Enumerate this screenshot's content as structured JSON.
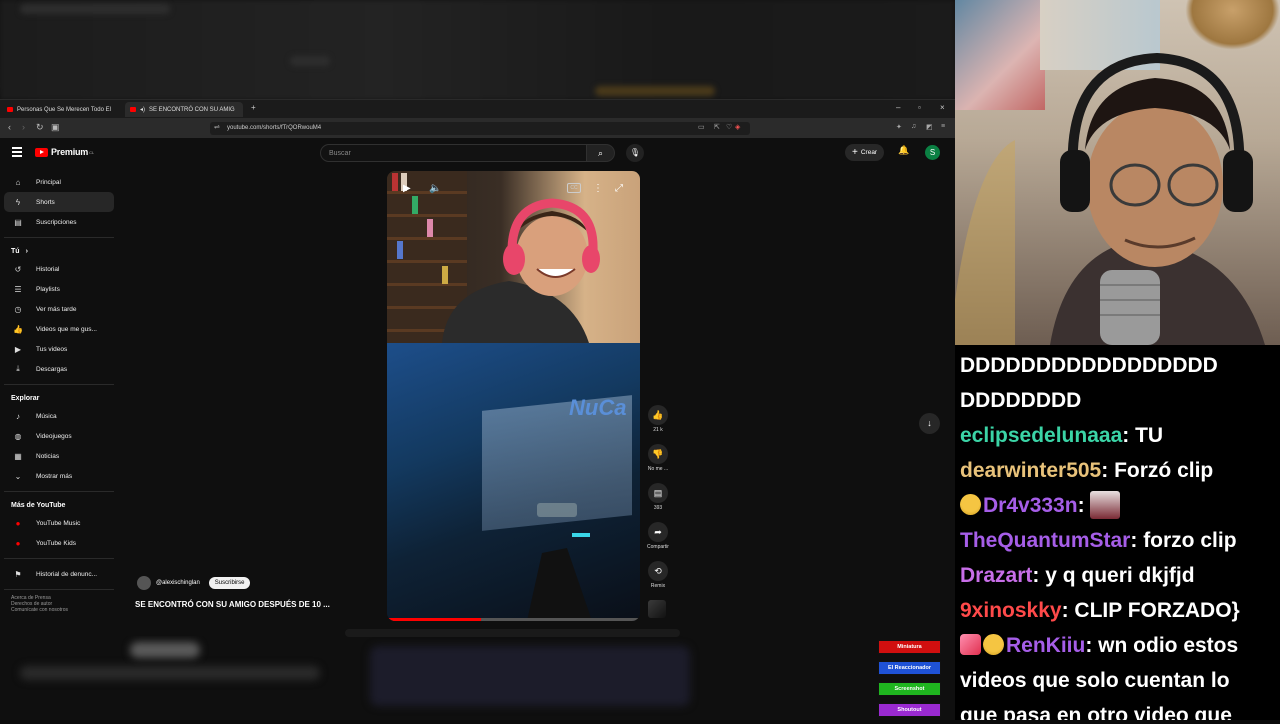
{
  "browser": {
    "tabs": [
      {
        "label": "Personas Que Se Merecen Todo El"
      },
      {
        "label": "SE ENCONTRÓ CON SU AMIG"
      }
    ],
    "url": "youtube.com/shorts/fTrQORwouM4"
  },
  "youtube": {
    "logo": "Premium",
    "logo_region": "CL",
    "search_placeholder": "Buscar",
    "create_label": "Crear",
    "avatar_letter": "S"
  },
  "sidebar": {
    "main": [
      {
        "label": "Principal",
        "icon": "home-icon"
      },
      {
        "label": "Shorts",
        "icon": "shorts-icon",
        "active": true
      },
      {
        "label": "Suscripciones",
        "icon": "subscriptions-icon"
      }
    ],
    "you_header": "Tú",
    "you": [
      {
        "label": "Historial",
        "icon": "history-icon"
      },
      {
        "label": "Playlists",
        "icon": "playlists-icon"
      },
      {
        "label": "Ver más tarde",
        "icon": "watch-later-icon"
      },
      {
        "label": "Videos que me gus...",
        "icon": "like-icon"
      },
      {
        "label": "Tus videos",
        "icon": "your-videos-icon"
      },
      {
        "label": "Descargas",
        "icon": "download-icon"
      }
    ],
    "explore_header": "Explorar",
    "explore": [
      {
        "label": "Música",
        "icon": "music-icon"
      },
      {
        "label": "Videojuegos",
        "icon": "gaming-icon"
      },
      {
        "label": "Noticias",
        "icon": "news-icon"
      },
      {
        "label": "Mostrar más",
        "icon": "chevron-down-icon"
      }
    ],
    "more_header": "Más de YouTube",
    "more": [
      {
        "label": "YouTube Music",
        "icon": "youtube-music-icon"
      },
      {
        "label": "YouTube Kids",
        "icon": "youtube-kids-icon"
      }
    ],
    "report": "Historial de denunc...",
    "footer": [
      "Acerca de  Prensa",
      "Derechos de autor",
      "Comunícate con nosotros"
    ]
  },
  "short": {
    "channel": "@alexischinglan",
    "subscribe": "Suscribirse",
    "title": "SE ENCONTRÓ CON SU AMIGO DESPUÉS DE 10 ...",
    "progress": 0.37,
    "actions": [
      {
        "label": "21 k",
        "icon": "thumbs-up-icon"
      },
      {
        "label": "No me ...",
        "icon": "thumbs-down-icon"
      },
      {
        "label": "393",
        "icon": "comment-icon"
      },
      {
        "label": "Compartir",
        "icon": "share-icon"
      },
      {
        "label": "Remix",
        "icon": "remix-icon"
      }
    ],
    "game_text": "NuCa"
  },
  "alerts": [
    {
      "label": "Miniatura",
      "color": "#d10f0f"
    },
    {
      "label": "El Reaccionador",
      "color": "#1f52d6"
    },
    {
      "label": "Screenshot",
      "color": "#1fb51f"
    },
    {
      "label": "Shoutout",
      "color": "#9a2ad1"
    }
  ],
  "chat": [
    {
      "user": "",
      "text": "DDDDDDDDDDDDDDDDD",
      "color": "#ffffff"
    },
    {
      "user": "",
      "text": "DDDDDDDD",
      "color": "#ffffff"
    },
    {
      "user": "eclipsedelunaaa",
      "text": " TU",
      "color": "#3bd4a6"
    },
    {
      "user": "dearwinter505",
      "text": " Forzó clip",
      "color": "#e8c27a"
    },
    {
      "user": "Dr4v333n",
      "text": "",
      "color": "#a65ee8",
      "badge": "sunglasses-emoji",
      "emote": true
    },
    {
      "user": "TheQuantumStar",
      "text": " forzo clip",
      "color": "#a65ee8"
    },
    {
      "user": "Drazart",
      "text": " y q queri dkjfjd",
      "color": "#c86ee8"
    },
    {
      "user": "9xinoskky",
      "text": " CLIP FORZADO}",
      "color": "#ff4a4a"
    },
    {
      "user": "RenKiiu",
      "text": " wn odio estos",
      "color": "#a65ee8",
      "badge": "gem-emoji"
    },
    {
      "user": "",
      "text": "videos que solo cuentan lo",
      "color": "#ffffff"
    },
    {
      "user": "",
      "text": "que pasa en otro video que",
      "color": "#ffffff"
    }
  ]
}
